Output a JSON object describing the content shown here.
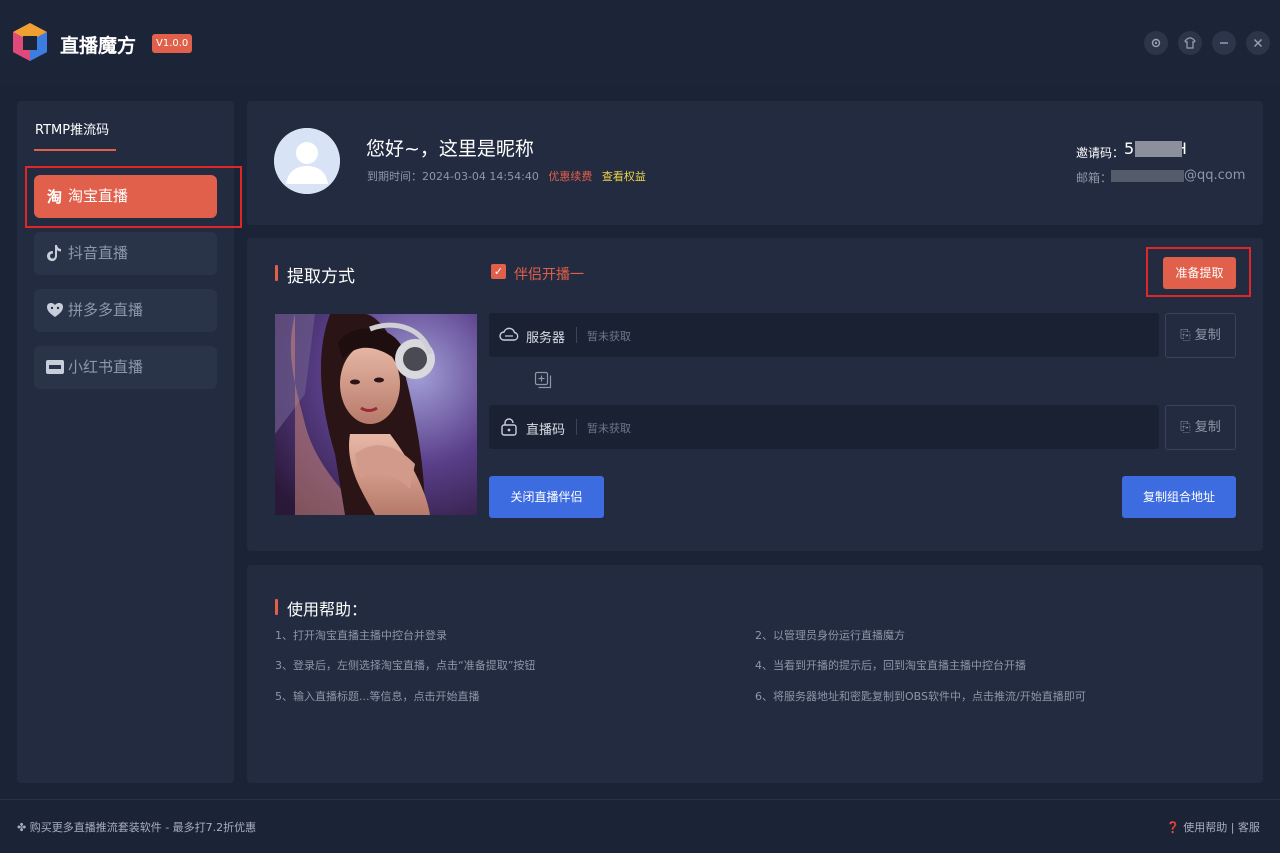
{
  "app": {
    "title": "直播魔方",
    "version": "V1.0.0"
  },
  "sidebar": {
    "heading": "RTMP推流码",
    "items": [
      {
        "label": "淘宝直播",
        "icon": "taobao-icon"
      },
      {
        "label": "抖音直播",
        "icon": "douyin-icon"
      },
      {
        "label": "拼多多直播",
        "icon": "pinduoduo-icon"
      },
      {
        "label": "小红书直播",
        "icon": "xiaohongshu-icon"
      }
    ]
  },
  "profile": {
    "greeting": "您好~，这里是昵称",
    "expire_text": "到期时间：2024-03-04 14:54:40",
    "renew_link": "优惠续费",
    "benefits_link": "查看权益",
    "invite_label": "邀请码：",
    "invite_code": "5        H",
    "email_label": "邮箱：",
    "email_domain": "@qq.com"
  },
  "extract": {
    "title": "提取方式",
    "companion_label": "伴侣开播一",
    "prepare_button": "准备提取",
    "server_label": "服务器",
    "server_value": "暂未获取",
    "stream_label": "直播码",
    "stream_value": "暂未获取",
    "copy_label": "复制",
    "close_companion_button": "关闭直播伴侣",
    "copy_combined_button": "复制组合地址"
  },
  "help": {
    "title": "使用帮助：",
    "steps": [
      "1、打开淘宝直播主播中控台并登录",
      "2、以管理员身份运行直播魔方",
      "3、登录后，左侧选择淘宝直播，点击“准备提取”按钮",
      "4、当看到开播的提示后，回到淘宝直播主播中控台开播",
      "5、输入直播标题...等信息，点击开始直播",
      "6、将服务器地址和密匙复制到OBS软件中，点击推流/开始直播即可"
    ]
  },
  "footer": {
    "promo": "购买更多直播推流套装软件 - 最多打7.2折优惠",
    "help_link": "使用帮助",
    "service_link": "客服"
  },
  "colors": {
    "accent": "#e0604b",
    "primary_blue": "#3d6be0",
    "background": "#1b2336",
    "panel": "#222b3f"
  }
}
